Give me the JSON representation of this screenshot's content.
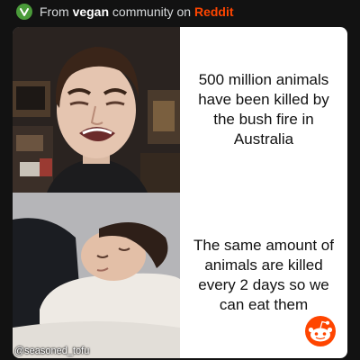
{
  "header": {
    "prefix": "From",
    "community": "vegan",
    "middle": "community on",
    "platform": "Reddit"
  },
  "meme": {
    "top_caption": "500 million animals have been killed by the bush fire in Australia",
    "bottom_caption": "The same amount of animals are killed every 2 days so we can eat them",
    "watermark": "@seasoned_tofu"
  },
  "colors": {
    "background": "#121212",
    "community_icon": "#4a9b3a",
    "reddit_orange": "#ff4500",
    "card": "#ffffff"
  },
  "icons": [
    "vegan-community-icon",
    "reddit-snoo-icon"
  ]
}
